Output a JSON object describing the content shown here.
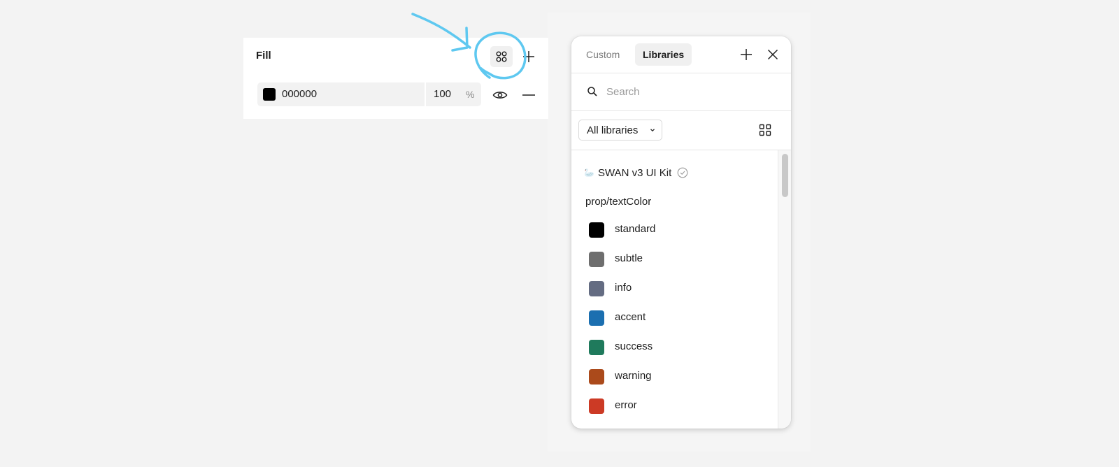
{
  "fill_panel": {
    "title": "Fill",
    "hex": "000000",
    "opacity": "100",
    "opacity_unit": "%",
    "swatch_color": "#000000",
    "icons": {
      "styles": "styles-grid-icon",
      "add": "plus-icon",
      "visibility": "eye-icon",
      "remove": "minus-icon"
    }
  },
  "annotation": {
    "color": "#5ec8f0",
    "icons": [
      "arrow-icon",
      "highlight-circle-icon"
    ]
  },
  "popover": {
    "tabs": [
      {
        "label": "Custom",
        "active": false
      },
      {
        "label": "Libraries",
        "active": true
      }
    ],
    "search": {
      "placeholder": "Search",
      "value": ""
    },
    "library_filter": {
      "selected": "All libraries"
    },
    "library": {
      "emoji": "🦢",
      "name": "SWAN v3 UI Kit",
      "group": "prop/textColor",
      "styles": [
        {
          "label": "standard",
          "color": "#000000"
        },
        {
          "label": "subtle",
          "color": "#6e6e6e"
        },
        {
          "label": "info",
          "color": "#646c82"
        },
        {
          "label": "accent",
          "color": "#1b6fb0"
        },
        {
          "label": "success",
          "color": "#1f7a5c"
        },
        {
          "label": "warning",
          "color": "#ab4a1b"
        },
        {
          "label": "error",
          "color": "#cc3a25"
        }
      ]
    }
  }
}
